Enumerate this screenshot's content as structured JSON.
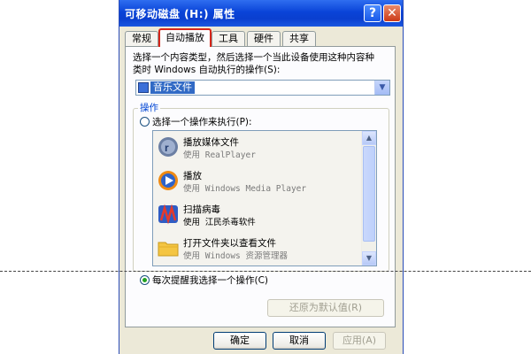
{
  "window": {
    "title": "可移动磁盘 (H:) 属性"
  },
  "title_buttons": {
    "help": "?",
    "close": "✕"
  },
  "tabs": [
    "常规",
    "自动播放",
    "工具",
    "硬件",
    "共享"
  ],
  "active_tab": "自动播放",
  "instruction": {
    "line1": "选择一个内容类型，然后选择一个当此设备使用这种内容种",
    "line2": "类时 Windows 自动执行的操作(S):"
  },
  "content_type": {
    "value": "音乐文件",
    "icon": "music-folder-icon"
  },
  "actions": {
    "group_label": "操作",
    "radio_select": "选择一个操作来执行(P):",
    "items": [
      {
        "title": "播放媒体文件",
        "sub": "使用 RealPlayer",
        "icon": "realplayer-icon"
      },
      {
        "title": "播放",
        "sub": "使用 Windows Media Player",
        "icon": "windows-media-player-icon"
      },
      {
        "title": "扫描病毒",
        "sub": "使用 江民杀毒软件",
        "icon": "antivirus-icon"
      },
      {
        "title": "打开文件夹以查看文件",
        "sub": "使用 Windows 资源管理器",
        "icon": "folder-icon"
      }
    ],
    "radio_prompt": "每次提醒我选择一个操作(C)",
    "selected": "radio_prompt"
  },
  "buttons": {
    "restore": "还原为默认值(R)",
    "ok": "确定",
    "cancel": "取消",
    "apply": "应用(A)"
  },
  "colors": {
    "titlebar": "#0a44d8",
    "active_tab_highlight": "#d7261a",
    "selection": "#316ac5"
  }
}
